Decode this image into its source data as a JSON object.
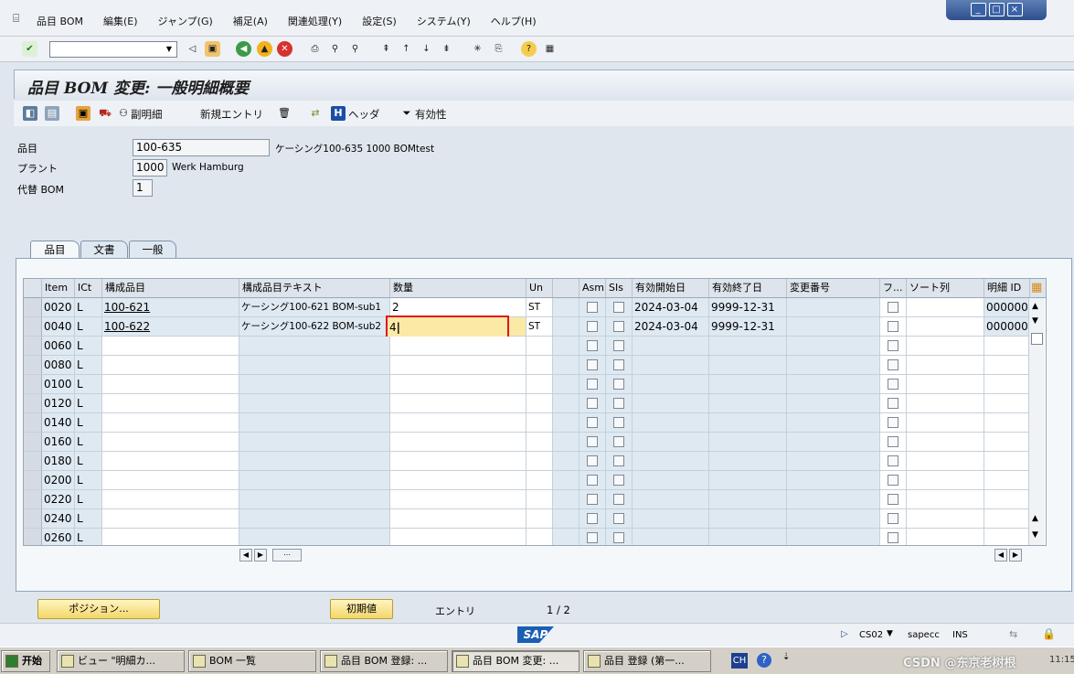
{
  "menu": {
    "items": [
      "品目 BOM",
      "編集(E)",
      "ジャンプ(G)",
      "補足(A)",
      "関連処理(Y)",
      "設定(S)",
      "システム(Y)",
      "ヘルプ(H)"
    ]
  },
  "window_controls": [
    "_",
    "□",
    "×"
  ],
  "title": "品目 BOM 変更: 一般明細概要",
  "app_toolbar": {
    "sub_item_label": "副明細",
    "new_entry_label": "新規エントリ",
    "header_label": "ヘッダ",
    "validity_label": "有効性"
  },
  "header": {
    "material_label": "品目",
    "material_value": "100-635",
    "material_desc": "ケーシング100-635 1000 BOMtest",
    "plant_label": "プラント",
    "plant_value": "1000",
    "plant_desc": "Werk Hamburg",
    "alt_bom_label": "代替 BOM",
    "alt_bom_value": "1"
  },
  "tabs": [
    "品目",
    "文書",
    "一般"
  ],
  "table": {
    "columns": [
      "Item",
      "ICt",
      "構成品目",
      "構成品目テキスト",
      "数量",
      "Un",
      "",
      "Asm",
      "SIs",
      "有効開始日",
      "有効終了日",
      "変更番号",
      "フ...",
      "ソート列",
      "明細 ID"
    ],
    "rows": [
      {
        "item": "0020",
        "ict": "L",
        "component": "100-621",
        "text": "ケーシング100-621 BOM-sub1",
        "qty": "2",
        "un": "ST",
        "valid_from": "2024-03-04",
        "valid_to": "9999-12-31",
        "item_id": "000000"
      },
      {
        "item": "0040",
        "ict": "L",
        "component": "100-622",
        "text": "ケーシング100-622 BOM-sub2",
        "qty": "4",
        "un": "ST",
        "valid_from": "2024-03-04",
        "valid_to": "9999-12-31",
        "item_id": "000000"
      },
      {
        "item": "0060",
        "ict": "L"
      },
      {
        "item": "0080",
        "ict": "L"
      },
      {
        "item": "0100",
        "ict": "L"
      },
      {
        "item": "0120",
        "ict": "L"
      },
      {
        "item": "0140",
        "ict": "L"
      },
      {
        "item": "0160",
        "ict": "L"
      },
      {
        "item": "0180",
        "ict": "L"
      },
      {
        "item": "0200",
        "ict": "L"
      },
      {
        "item": "0220",
        "ict": "L"
      },
      {
        "item": "0240",
        "ict": "L"
      },
      {
        "item": "0260",
        "ict": "L"
      }
    ]
  },
  "footer": {
    "position_button": "ポジション...",
    "initial_button": "初期値",
    "entry_label": "エントリ",
    "entry_count": "1 / 2"
  },
  "status": {
    "transaction": "CS02",
    "system": "sapecc",
    "mode": "INS"
  },
  "taskbar": {
    "start": "开始",
    "tasks": [
      "ビュー \"明細カ...",
      "BOM 一覧",
      "品目 BOM 登録: ...",
      "品目 BOM 変更: ...",
      "品目 登録 (第一..."
    ],
    "lang": "CH",
    "watermark": "CSDN @东京老树根",
    "clock": "11:15"
  },
  "colors": {
    "accent_red": "#e0141b",
    "sap_blue": "#1b5fb4",
    "button_yellow": "#f3d76a"
  }
}
